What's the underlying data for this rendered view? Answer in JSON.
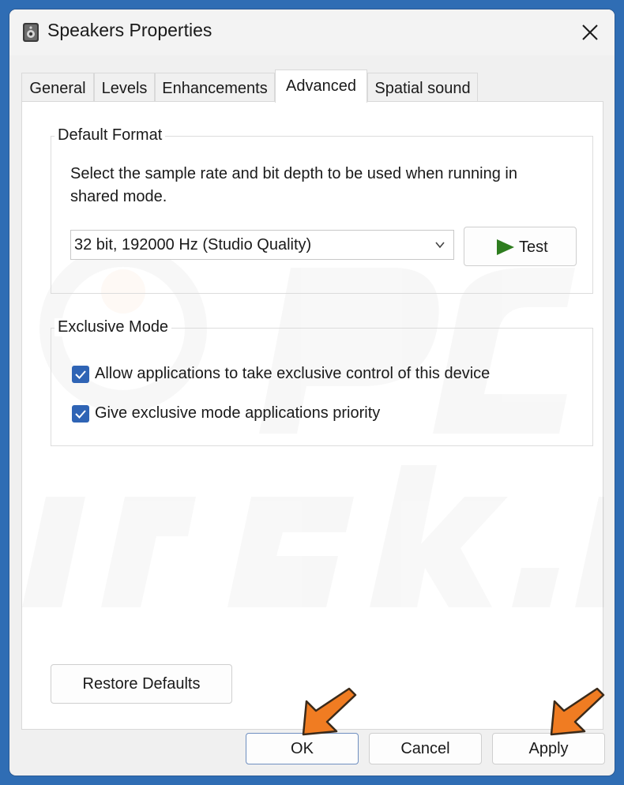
{
  "window": {
    "title": "Speakers Properties"
  },
  "tabs": [
    {
      "label": "General"
    },
    {
      "label": "Levels"
    },
    {
      "label": "Enhancements"
    },
    {
      "label": "Advanced",
      "active": true
    },
    {
      "label": "Spatial sound"
    }
  ],
  "default_format": {
    "group_label": "Default Format",
    "description_line1": "Select the sample rate and bit depth to be used when running in",
    "description_line2": "shared mode.",
    "selected_format": "32 bit, 192000 Hz (Studio Quality)",
    "test_label": "Test"
  },
  "exclusive_mode": {
    "group_label": "Exclusive Mode",
    "options": [
      {
        "label": "Allow applications to take exclusive control of this device",
        "checked": true
      },
      {
        "label": "Give exclusive mode applications priority",
        "checked": true
      }
    ]
  },
  "restore_defaults_label": "Restore Defaults",
  "footer": {
    "ok_label": "OK",
    "cancel_label": "Cancel",
    "apply_label": "Apply"
  },
  "colors": {
    "desktop": "#2f6db4",
    "checkbox_accent": "#2f64b5",
    "test_icon": "#2e7d1f",
    "annotation_arrow": "#f07c22"
  },
  "icons": {
    "title": "speaker-icon",
    "close": "close-icon",
    "dropdown": "chevron-down-icon",
    "test": "play-icon",
    "check": "checkmark-icon",
    "annotation": "pointer-arrow-icon"
  }
}
